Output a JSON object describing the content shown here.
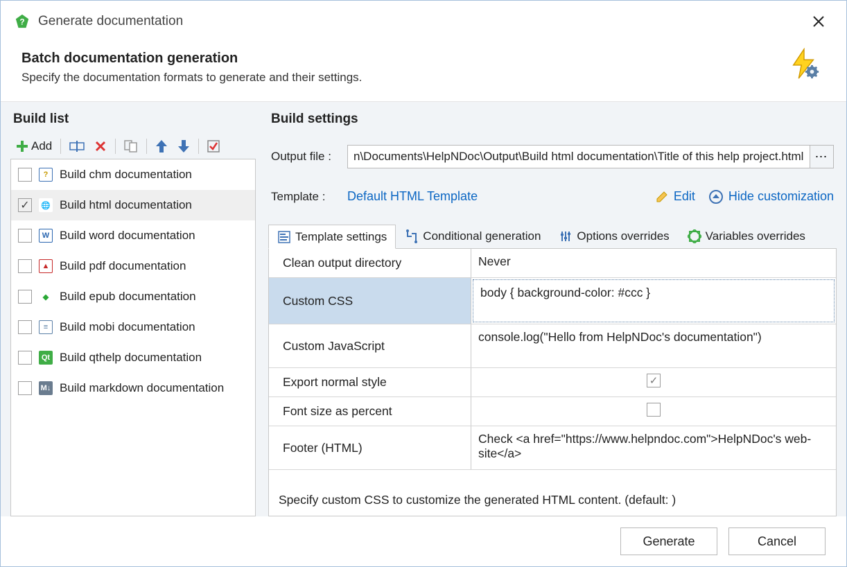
{
  "window": {
    "title": "Generate documentation"
  },
  "header": {
    "title": "Batch documentation generation",
    "subtitle": "Specify the documentation formats to generate and their settings."
  },
  "left": {
    "title": "Build list",
    "add_label": "Add",
    "items": [
      {
        "label": "Build chm documentation",
        "checked": false,
        "icon": "chm-icon"
      },
      {
        "label": "Build html documentation",
        "checked": true,
        "icon": "html-icon",
        "selected": true
      },
      {
        "label": "Build word documentation",
        "checked": false,
        "icon": "word-icon"
      },
      {
        "label": "Build pdf documentation",
        "checked": false,
        "icon": "pdf-icon"
      },
      {
        "label": "Build epub documentation",
        "checked": false,
        "icon": "epub-icon"
      },
      {
        "label": "Build mobi documentation",
        "checked": false,
        "icon": "mobi-icon"
      },
      {
        "label": "Build qthelp documentation",
        "checked": false,
        "icon": "qt-icon"
      },
      {
        "label": "Build markdown documentation",
        "checked": false,
        "icon": "markdown-icon"
      }
    ]
  },
  "right": {
    "title": "Build settings",
    "output_label": "Output file :",
    "output_value": "n\\Documents\\HelpNDoc\\Output\\Build html documentation\\Title of this help project.html",
    "template_label": "Template :",
    "template_name": "Default HTML Template",
    "edit_link": "Edit",
    "hide_link": "Hide customization",
    "tabs": [
      {
        "label": "Template settings",
        "icon": "template-settings-icon"
      },
      {
        "label": "Conditional generation",
        "icon": "conditional-icon"
      },
      {
        "label": "Options overrides",
        "icon": "options-icon"
      },
      {
        "label": "Variables overrides",
        "icon": "variables-icon"
      }
    ],
    "active_tab": 0,
    "settings": [
      {
        "label": "Clean output directory",
        "type": "text",
        "value": "Never"
      },
      {
        "label": "Custom CSS",
        "type": "text",
        "value": "body { background-color: #ccc }",
        "selected": true,
        "tall": true
      },
      {
        "label": "Custom JavaScript",
        "type": "text",
        "value": "console.log(\"Hello from HelpNDoc's documentation\")",
        "tall": true
      },
      {
        "label": "Export normal style",
        "type": "check",
        "checked": true
      },
      {
        "label": "Font size as percent",
        "type": "check",
        "checked": false
      },
      {
        "label": "Footer (HTML)",
        "type": "text",
        "value": "Check <a href=\"https://www.helpndoc.com\">HelpNDoc's web-site</a>",
        "tall": true
      }
    ],
    "hint": "Specify custom CSS to customize the generated HTML content. (default: )"
  },
  "footer": {
    "generate": "Generate",
    "cancel": "Cancel"
  },
  "icons": {
    "chm-icon": {
      "text": "?",
      "bg": "#fff",
      "fg": "#c79a00",
      "border": "#3e72b5"
    },
    "html-icon": {
      "text": "🌐",
      "bg": "#fff",
      "fg": "#2a66b0",
      "border": "none"
    },
    "word-icon": {
      "text": "W",
      "bg": "#fff",
      "fg": "#2a66b0",
      "border": "#2a66b0"
    },
    "pdf-icon": {
      "text": "▲",
      "bg": "#fff",
      "fg": "#c62828",
      "border": "#c62828"
    },
    "epub-icon": {
      "text": "◆",
      "bg": "#fff",
      "fg": "#2aa835",
      "border": "none"
    },
    "mobi-icon": {
      "text": "≡",
      "bg": "#fff",
      "fg": "#5a7fa6",
      "border": "#5a7fa6"
    },
    "qt-icon": {
      "text": "Qt",
      "bg": "#3fad46",
      "fg": "#fff",
      "border": "none"
    },
    "markdown-icon": {
      "text": "M↓",
      "bg": "#6a7c8f",
      "fg": "#fff",
      "border": "none"
    }
  }
}
